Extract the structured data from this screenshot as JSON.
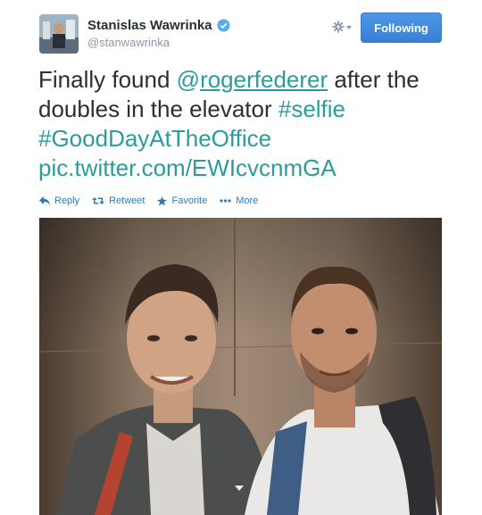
{
  "user": {
    "fullname": "Stanislas Wawrinka",
    "handle": "@stanwawrinka",
    "verified": true
  },
  "follow_button": {
    "label": "Following"
  },
  "tweet": {
    "text_1": "Finally found ",
    "mention_at": "@",
    "mention_name": "rogerfederer",
    "text_2": " after the doubles in the elevator ",
    "hashtag_1": "#selfie",
    "hashtag_2": "#GoodDayAtTheOffice",
    "pic_link": "pic.twitter.com/EWIcvcnmGA"
  },
  "actions": {
    "reply": "Reply",
    "retweet": "Retweet",
    "favorite": "Favorite",
    "more": "More"
  },
  "icons": {
    "reply": "reply-icon",
    "retweet": "retweet-icon",
    "favorite": "star-icon",
    "more": "more-dots-icon",
    "settings": "gear-icon",
    "verified": "verified-badge-icon"
  },
  "colors": {
    "link": "#2b9c9c",
    "action": "#2b7bb9",
    "follow_button": "#4a90e2",
    "verified": "#55acee"
  }
}
